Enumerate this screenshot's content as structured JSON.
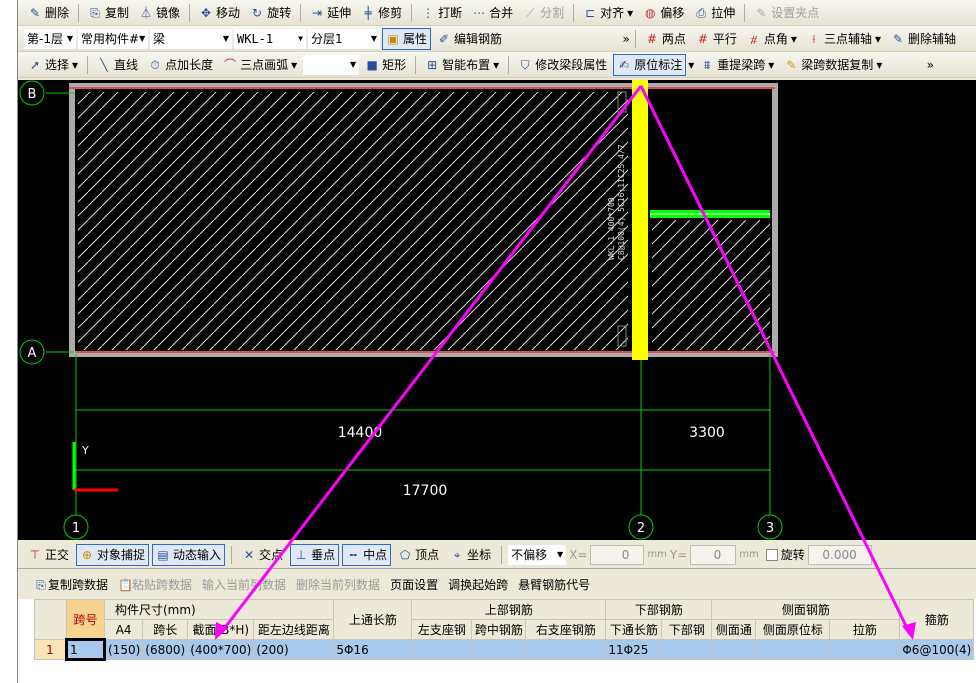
{
  "toolbar1": [
    "删除",
    "复制",
    "镜像",
    "移动",
    "旋转",
    "延伸",
    "修剪",
    "打断",
    "合并",
    "分割",
    "对齐",
    "偏移",
    "拉伸",
    "设置夹点"
  ],
  "toolbar2": {
    "floor": "第-1层",
    "category": "常用构件#",
    "type": "梁",
    "component": "WKL-1",
    "layer": "分层1",
    "property": "属性",
    "edit_rebar": "编辑钢筋",
    "aux": [
      "两点",
      "平行",
      "点角",
      "三点辅轴",
      "删除辅轴"
    ]
  },
  "toolbar3": {
    "select": "选择",
    "line": "直线",
    "point_len": "点加长度",
    "arc": "三点画弧",
    "rect": "矩形",
    "smart": "智能布置",
    "modify_span": "修改梁段属性",
    "in_situ": "原位标注",
    "re_span": "重提梁跨",
    "copy_span": "梁跨数据复制"
  },
  "canvas": {
    "axes": [
      "B",
      "A",
      "1",
      "2",
      "3"
    ],
    "dims": [
      "14400",
      "3300",
      "17700"
    ],
    "beam_label1": "WKL-1 400*700",
    "beam_label2": "C8@100(4) 5C16;11C25 4/7",
    "ucs_y": "Y"
  },
  "snap": {
    "ortho": "正交",
    "obj_snap": "对象捕捉",
    "dyn_input": "动态输入",
    "intersect": "交点",
    "perp": "垂点",
    "mid": "中点",
    "vertex": "顶点",
    "coord": "坐标",
    "offset": "不偏移",
    "x_label": "X=",
    "x_val": "0",
    "y_label": "Y=",
    "y_val": "0",
    "unit": "mm",
    "rotate": "旋转",
    "rot_val": "0.000"
  },
  "panel": {
    "tools": [
      "复制跨数据",
      "粘贴跨数据",
      "输入当前列数据",
      "删除当前列数据",
      "页面设置",
      "调换起始跨",
      "悬臂钢筋代号"
    ],
    "headers": {
      "span": "跨号",
      "size": "构件尺寸(mm)",
      "top_through": "上通长筋",
      "top_rebar": "上部钢筋",
      "bottom_rebar": "下部钢筋",
      "side_rebar": "侧面钢筋",
      "stirrup": "箍筋",
      "sub": [
        "A4",
        "跨长",
        "截面(B*H)",
        "距左边线距离",
        "左支座钢",
        "跨中钢筋",
        "右支座钢筋",
        "下通长筋",
        "下部钢",
        "侧面通",
        "侧面原位标",
        "拉筋"
      ]
    },
    "row": {
      "num": "1",
      "span": "1",
      "a4": "(150)",
      "len": "(6800)",
      "section": "(400*700)",
      "dist": "(200)",
      "top": "5Φ16",
      "bottom": "11Φ25",
      "stirrup": "Φ6@100(4)"
    }
  }
}
